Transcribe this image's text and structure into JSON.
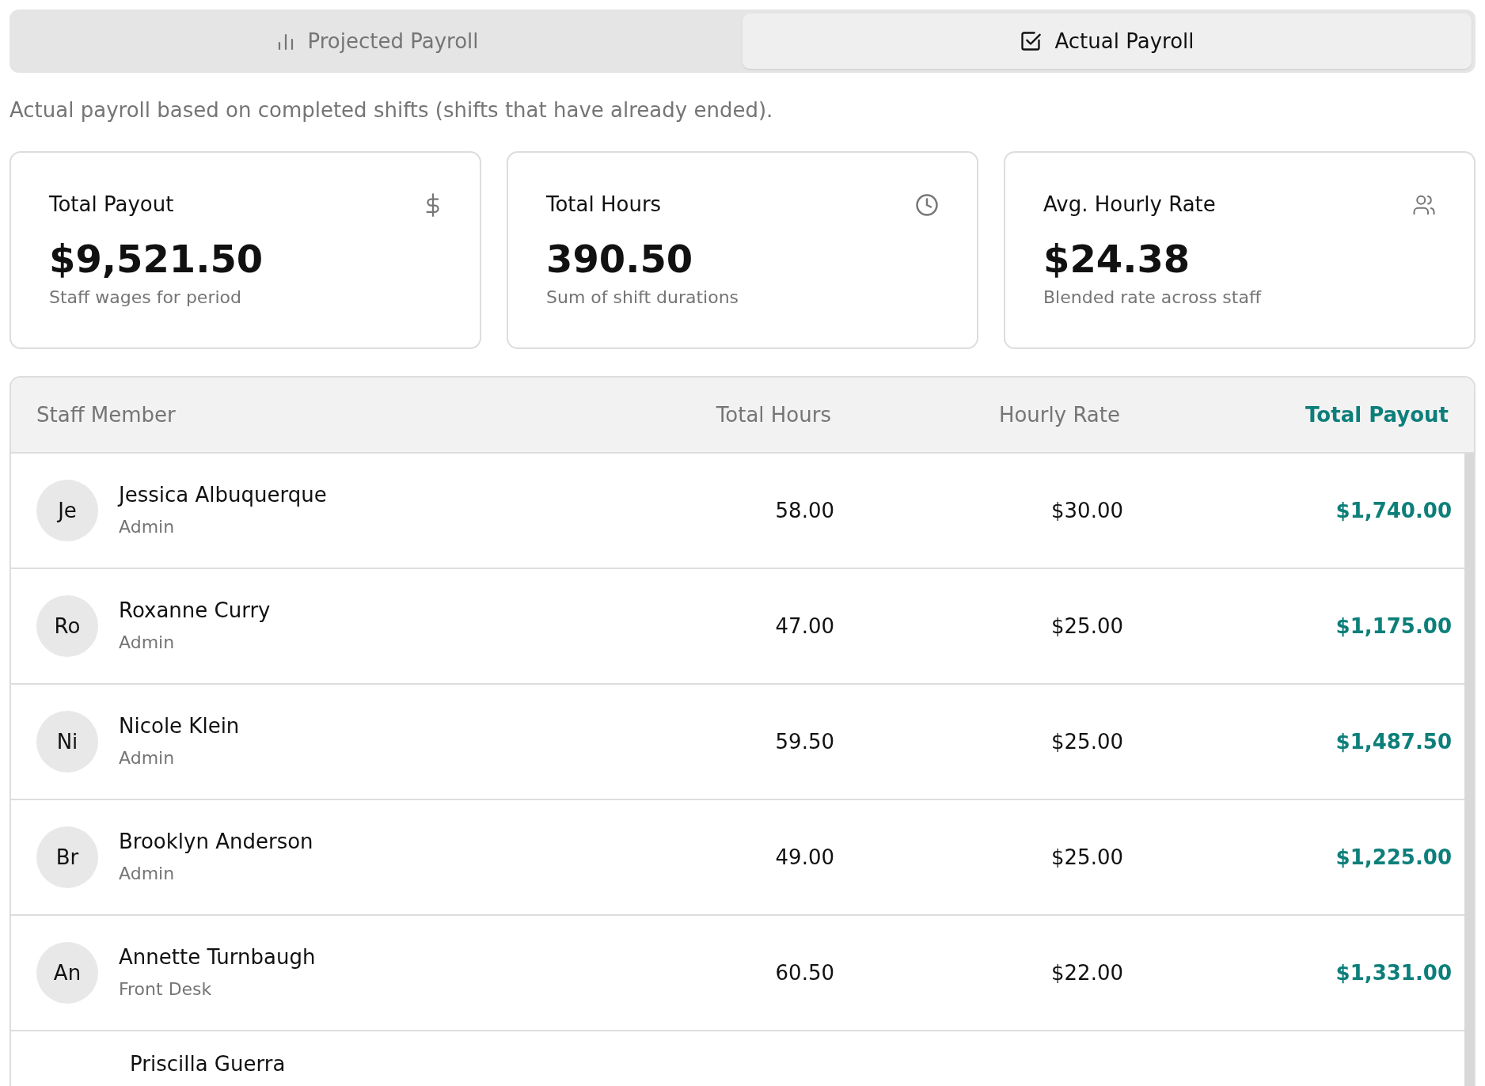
{
  "tabs": [
    {
      "label": "Projected Payroll",
      "selected": false
    },
    {
      "label": "Actual Payroll",
      "selected": true
    }
  ],
  "description": "Actual payroll based on completed shifts (shifts that have already ended).",
  "summary_cards": [
    {
      "title": "Total Payout",
      "value": "$9,521.50",
      "caption": "Staff wages for period"
    },
    {
      "title": "Total Hours",
      "value": "390.50",
      "caption": "Sum of shift durations"
    },
    {
      "title": "Avg. Hourly Rate",
      "value": "$24.38",
      "caption": "Blended rate across staff"
    }
  ],
  "table": {
    "columns": [
      "Staff Member",
      "Total Hours",
      "Hourly Rate",
      "Total Payout"
    ],
    "rows": [
      {
        "initials": "Je",
        "name": "Jessica Albuquerque",
        "role": "Admin",
        "hours": "58.00",
        "rate": "$30.00",
        "payout": "$1,740.00"
      },
      {
        "initials": "Ro",
        "name": "Roxanne Curry",
        "role": "Admin",
        "hours": "47.00",
        "rate": "$25.00",
        "payout": "$1,175.00"
      },
      {
        "initials": "Ni",
        "name": "Nicole Klein",
        "role": "Admin",
        "hours": "59.50",
        "rate": "$25.00",
        "payout": "$1,487.50"
      },
      {
        "initials": "Br",
        "name": "Brooklyn Anderson",
        "role": "Admin",
        "hours": "49.00",
        "rate": "$25.00",
        "payout": "$1,225.00"
      },
      {
        "initials": "An",
        "name": "Annette Turnbaugh",
        "role": "Front Desk",
        "hours": "60.50",
        "rate": "$22.00",
        "payout": "$1,331.00"
      },
      {
        "name": "Priscilla Guerra"
      }
    ]
  }
}
